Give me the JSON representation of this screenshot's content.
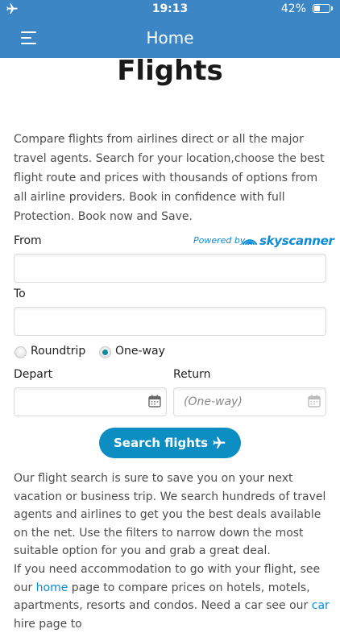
{
  "status_bar": {
    "time": "19:13",
    "battery_percent": "42%",
    "battery_level": 0.42
  },
  "nav": {
    "title": "Home"
  },
  "page": {
    "heading": "Flights",
    "intro": "Compare flights from airlines direct or all the major travel agents. Search for your location,choose the best flight route and prices with thousands of options from all airline providers. Book in confidence with full Protection. Book now and Save."
  },
  "form": {
    "from_label": "From",
    "to_label": "To",
    "from_value": "",
    "to_value": "",
    "powered_by": "Powered by",
    "provider": "skyscanner",
    "trip_types": [
      "Roundtrip",
      "One-way"
    ],
    "selected_trip_type": "One-way",
    "depart_label": "Depart",
    "return_label": "Return",
    "depart_value": "",
    "return_placeholder": "(One-way)",
    "search_button": "Search flights"
  },
  "footer_text": {
    "p1": "Our flight search is sure to save you on your next vacation or business trip. We search hundreds of travel agents and airlines to get you the best deals available on the net. Use the filters to narrow down the most suitable option for you and grab a great deal.",
    "p2_before": "If you need accommodation to go with your flight, see our ",
    "p2_link_home": "home",
    "p2_middle": " page to compare prices on hotels, motels, apartments, resorts and condos. Need a car see our ",
    "p2_link_car": "car",
    "p2_after": " hire page to"
  },
  "colors": {
    "header": "#3d86c6",
    "accent": "#0c8ec2",
    "link": "#0b8bd6"
  }
}
